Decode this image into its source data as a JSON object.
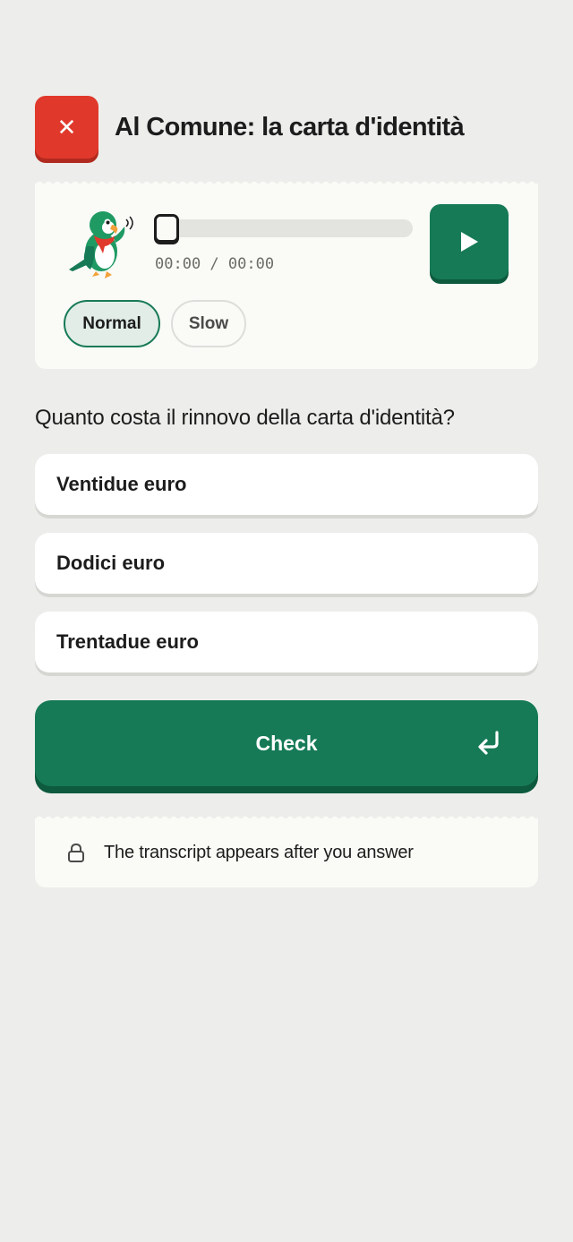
{
  "header": {
    "close_icon": "close-icon",
    "title": "Al Comune: la carta d'identità"
  },
  "audio": {
    "mascot_icon": "parrot-mascot-icon",
    "progress": 0,
    "time_display": "00:00 / 00:00",
    "play_icon": "play-icon",
    "speed_options": [
      {
        "label": "Normal",
        "selected": true
      },
      {
        "label": "Slow",
        "selected": false
      }
    ]
  },
  "question": {
    "text": "Quanto costa il rinnovo della carta d'identità?",
    "options": [
      {
        "label": "Ventidue euro"
      },
      {
        "label": "Dodici euro"
      },
      {
        "label": "Trentadue euro"
      }
    ]
  },
  "check_button": {
    "label": "Check",
    "icon": "enter-return-icon"
  },
  "transcript": {
    "icon": "lock-icon",
    "text": "The transcript appears after you answer"
  },
  "colors": {
    "background": "#edeeeb",
    "primary_green": "#167a56",
    "close_red": "#e0392b",
    "card": "#fafaf7"
  }
}
